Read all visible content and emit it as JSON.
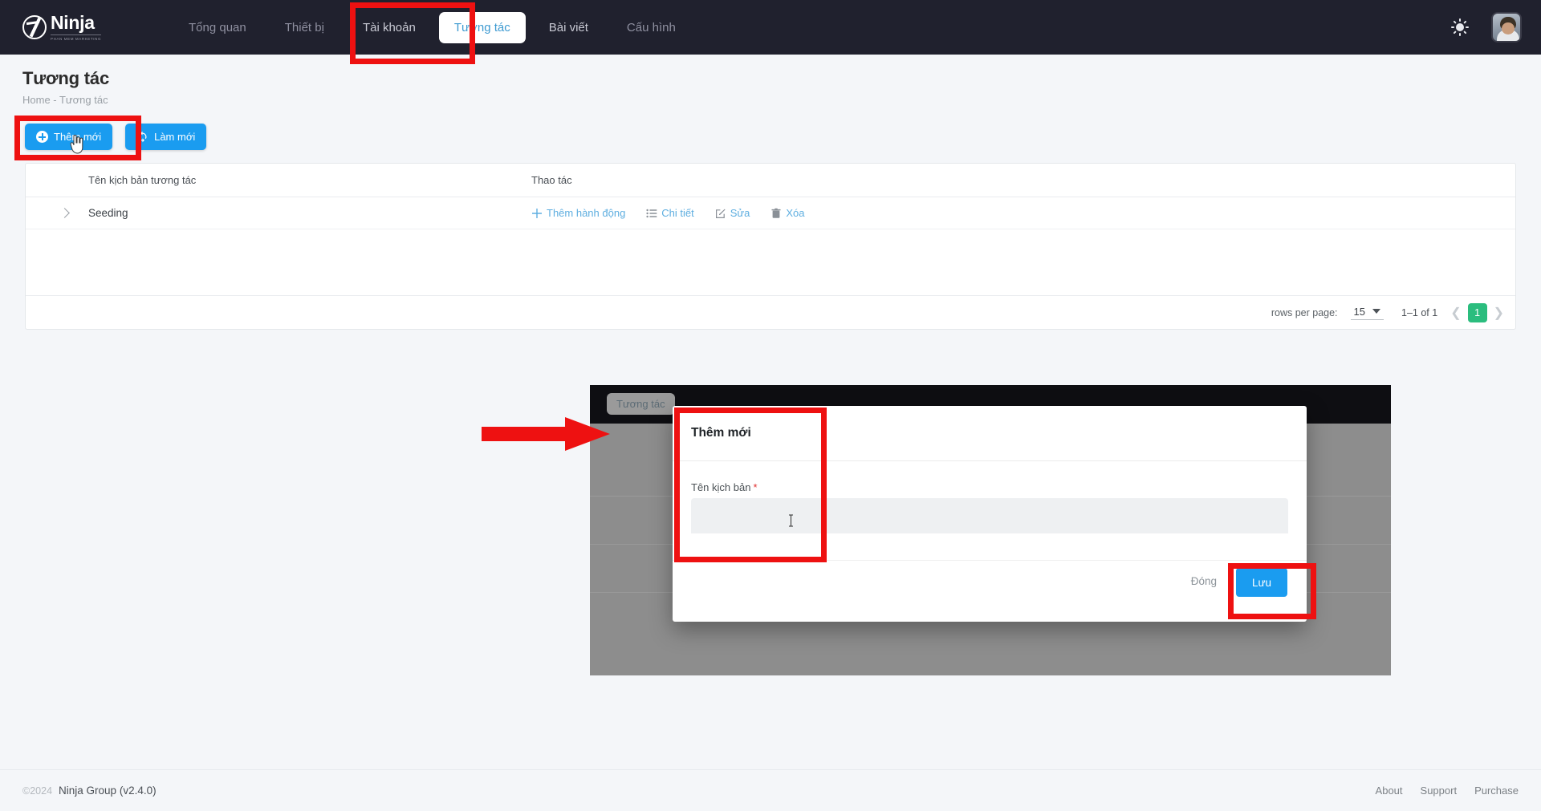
{
  "header": {
    "brand": {
      "name": "Ninja",
      "tagline": "PHAN MEM MARKETING"
    },
    "nav": [
      {
        "label": "Tổng quan",
        "active": false
      },
      {
        "label": "Thiết bị",
        "active": false
      },
      {
        "label": "Tài khoản",
        "active": false
      },
      {
        "label": "Tương tác",
        "active": true
      },
      {
        "label": "Bài viết",
        "active": false
      },
      {
        "label": "Cấu hình",
        "active": false
      }
    ],
    "theme_toggle_icon": "sun-icon",
    "avatar_icon": "user-avatar"
  },
  "heading": {
    "title": "Tương tác",
    "breadcrumb": "Home  -  Tương tác"
  },
  "toolbar": {
    "add_label": "Thêm mới",
    "add_icon": "plus-circle-icon",
    "refresh_label": "Làm mới",
    "refresh_icon": "refresh-icon"
  },
  "table": {
    "columns": [
      "",
      "Tên kịch bản tương tác",
      "Thao tác"
    ],
    "rows": [
      {
        "expand_icon": "chevron-right-icon",
        "name": "Seeding",
        "actions": [
          {
            "label": "Thêm hành động",
            "icon": "plus-icon"
          },
          {
            "label": "Chi tiết",
            "icon": "list-icon"
          },
          {
            "label": "Sửa",
            "icon": "edit-icon"
          },
          {
            "label": "Xóa",
            "icon": "trash-icon"
          }
        ]
      }
    ],
    "pagination": {
      "rows_per_page_label": "rows per page:",
      "rows_per_page_value": "15",
      "range": "1–1 of 1",
      "prev_icon": "chevron-left-icon",
      "next_icon": "chevron-right-icon",
      "current_page": "1"
    }
  },
  "inset": {
    "nav_pill": "Tương tác",
    "dialog": {
      "title": "Thêm mới",
      "field_label": "Tên kịch bản",
      "required_mark": "*",
      "field_value": "",
      "field_placeholder": "",
      "close_label": "Đóng",
      "save_label": "Lưu"
    }
  },
  "footer": {
    "copyright": "©2024",
    "company": "Ninja Group (v2.4.0)",
    "links": [
      "About",
      "Support",
      "Purchase"
    ]
  },
  "colors": {
    "primary_blue": "#1a9cf0",
    "header_dark": "#20212e",
    "page_bg": "#f4f6f9",
    "pager_green": "#2bbd7e",
    "annotation_red": "#ee1111",
    "required_red": "#e03131"
  }
}
